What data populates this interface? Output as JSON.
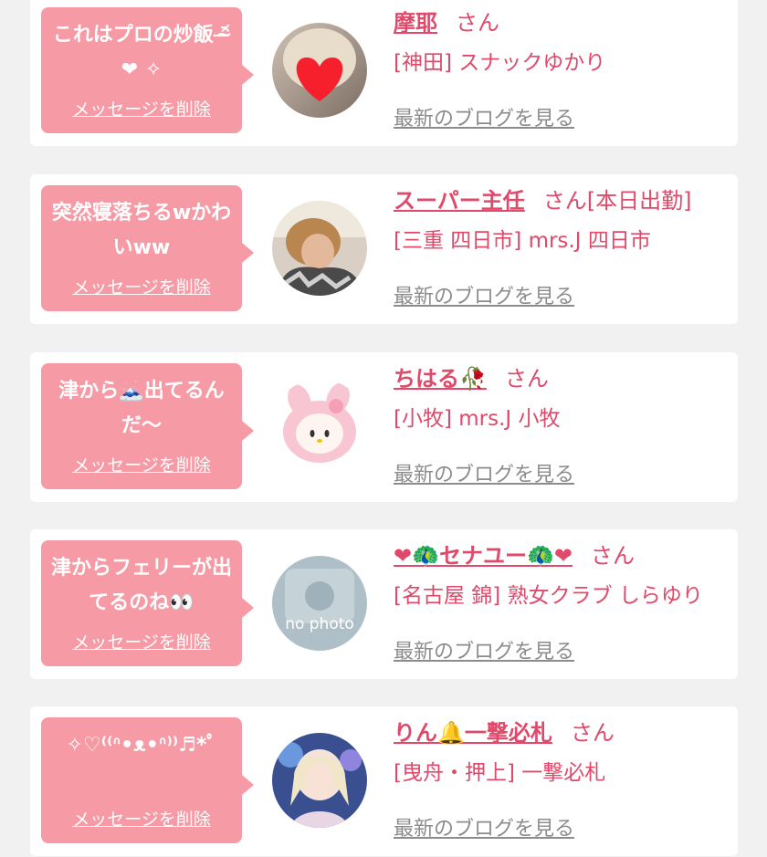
{
  "delete_label": "メッセージを削除",
  "blog_label": "最新のブログを見る",
  "items": [
    {
      "message": "これはプロの炒飯 ᵔ̴̶᷄ ❤ ✧",
      "name": "摩耶",
      "honorific": "さん",
      "shop": "[神田] スナックゆかり",
      "avatar": "heart-emoji-photo"
    },
    {
      "message": "突然寝落ちるwかわいww",
      "name": "スーパー主任",
      "honorific": "さん[本日出勤]",
      "shop": "[三重 四日市] mrs.J 四日市",
      "avatar": "person-photo"
    },
    {
      "message": "津から🗻出てるんだ〜",
      "name": "ちはる🥀",
      "honorific": "さん",
      "shop": "[小牧] mrs.J 小牧",
      "avatar": "plush-toy-photo"
    },
    {
      "message": "津からフェリーが出てるのね👀",
      "name": "❤🦚セナユー🦚❤",
      "honorific": "さん",
      "shop": "[名古屋 錦] 熟女クラブ しらゆり",
      "avatar_text": "no photo",
      "avatar": "no-photo-placeholder"
    },
    {
      "message": "✧♡⁽⁽ᐢ•ᴥ•ᐢ⁾⁾♬*ﾟ",
      "name": "りん🔔一撃必札",
      "honorific": "さん",
      "shop": "[曳舟・押上] 一撃必札",
      "avatar": "girl-photo"
    }
  ]
}
